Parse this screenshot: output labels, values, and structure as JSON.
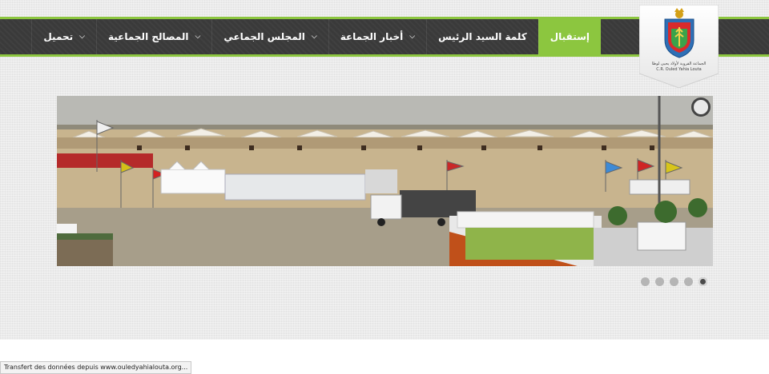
{
  "nav": {
    "items": [
      {
        "label": "إستقبال",
        "active": true,
        "dropdown": false
      },
      {
        "label": "كلمة السيد الرئيس",
        "active": false,
        "dropdown": false
      },
      {
        "label": "أخبار الجماعة",
        "active": false,
        "dropdown": true
      },
      {
        "label": "المجلس الجماعي",
        "active": false,
        "dropdown": true
      },
      {
        "label": "المصالح الجماعية",
        "active": false,
        "dropdown": true
      },
      {
        "label": "تحميل",
        "active": false,
        "dropdown": true
      }
    ],
    "dropdown_icon": "chevron-down-icon"
  },
  "logo": {
    "text_ar": "الجماعة القروية لأولاد يحيى لوطا",
    "text_fr": "C.R. Ouled Yahia Louta",
    "icon": "shield-crest-icon"
  },
  "slider": {
    "image": "outdoor fantasia festival grounds with tents, flags, horses and trucks",
    "slides_total": 5,
    "active_slide": 5
  },
  "status_bar": {
    "text": "Transfert des données depuis www.ouledyahialouta.org..."
  },
  "colors": {
    "accent": "#8cc63f",
    "nav_bg": "#3a3a3a",
    "page_bg": "#ebebeb"
  }
}
